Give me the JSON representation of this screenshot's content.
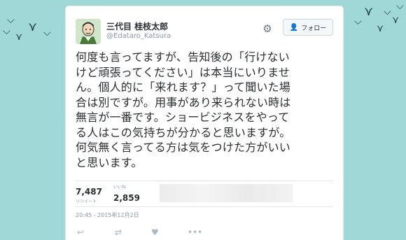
{
  "user": {
    "display_name": "三代目 桂枝太郎",
    "handle": "@Edataro_Katsura"
  },
  "follow_button": {
    "label": "フォロー",
    "icon": "add-user-icon"
  },
  "tweet": {
    "lines": [
      "何度も言ってますが、告知後の「行けない",
      "けど頑張ってください」は本当にいりませ",
      "ん。個人的に「来れます？」って聞いた場",
      "合は別ですが。用事があり来られない時は",
      "無言が一番です。ショービジネスをやって",
      "る人はこの気持ちが分かると思いますが。",
      "何気無く言ってる方は気をつけた方がいい",
      "と思います。"
    ]
  },
  "stats": {
    "retweets": {
      "value": "7,487",
      "label": "リツイート"
    },
    "likes": {
      "value": "2,859",
      "label": "いいね"
    }
  },
  "timestamp": "20:45 - 2015年12月2日",
  "colors": {
    "background": "#9fd8d6",
    "card": "#ffffff",
    "text": "#292f33",
    "muted": "#8899a6",
    "accent": "#55acee"
  }
}
